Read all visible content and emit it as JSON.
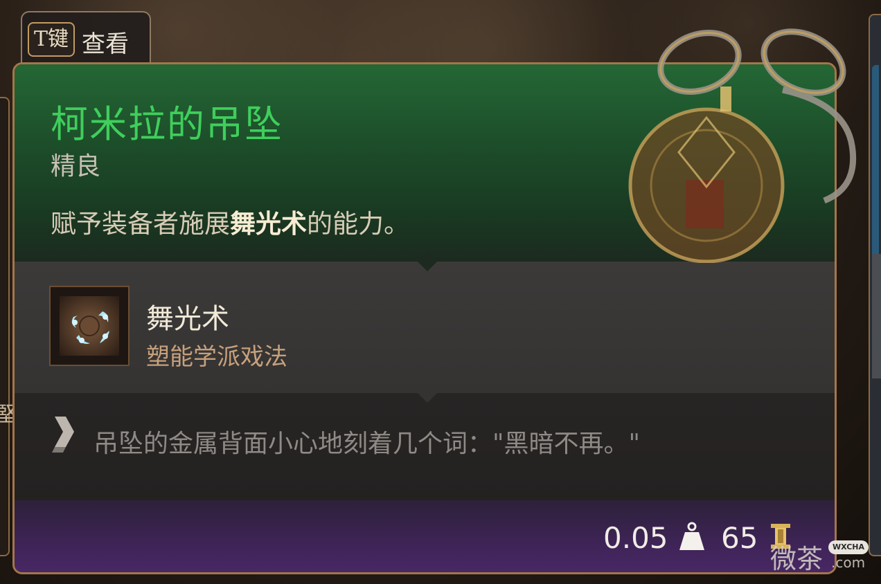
{
  "key_hint": {
    "key": "T键",
    "label": "查看"
  },
  "side": {
    "left_char": "堅"
  },
  "item": {
    "name": "柯米拉的吊坠",
    "rarity": "精良",
    "description_before": "赋予装备者施展",
    "description_highlight": "舞光术",
    "description_after": "的能力。",
    "name_color": "#3fcf5c"
  },
  "spell": {
    "name": "舞光术",
    "school": "塑能学派戏法",
    "icon": "dancing-lights-spell-icon"
  },
  "flavor": {
    "icon": "scroll-note-icon",
    "text": "吊坠的金属背面小心地刻着几个词：\"黑暗不再。\""
  },
  "footer": {
    "weight": "0.05",
    "weight_icon": "weight-icon",
    "price": "65",
    "price_icon": "gold-coin-icon"
  },
  "watermark": {
    "text": "微茶",
    "badge": "WXCHA",
    "domain": ".com"
  }
}
